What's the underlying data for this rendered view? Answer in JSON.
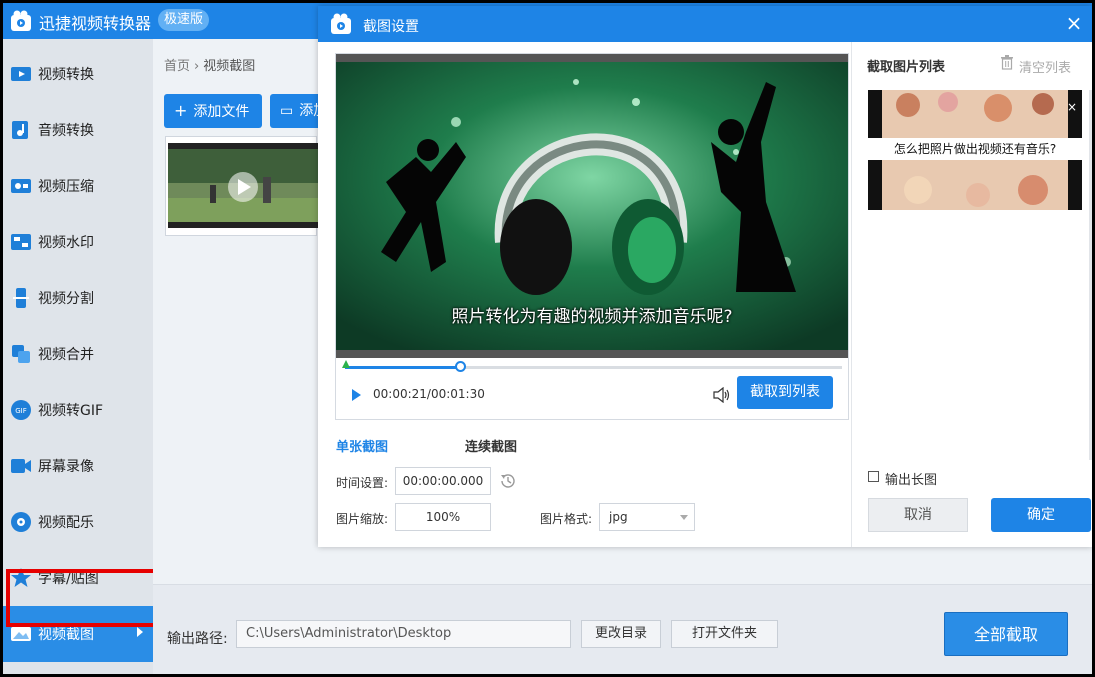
{
  "app": {
    "title": "迅捷视频转换器",
    "badge": "极速版",
    "brand_color": "#1e84e6"
  },
  "sidebar": {
    "items": [
      {
        "label": "视频转换",
        "icon": "video-convert-icon"
      },
      {
        "label": "音频转换",
        "icon": "audio-convert-icon"
      },
      {
        "label": "视频压缩",
        "icon": "video-compress-icon"
      },
      {
        "label": "视频水印",
        "icon": "video-watermark-icon"
      },
      {
        "label": "视频分割",
        "icon": "video-split-icon"
      },
      {
        "label": "视频合并",
        "icon": "video-merge-icon"
      },
      {
        "label": "视频转GIF",
        "icon": "video-gif-icon"
      },
      {
        "label": "屏幕录像",
        "icon": "screen-record-icon"
      },
      {
        "label": "视频配乐",
        "icon": "video-music-icon"
      },
      {
        "label": "字幕/贴图",
        "icon": "subtitle-sticker-icon"
      },
      {
        "label": "视频截图",
        "icon": "video-screenshot-icon",
        "active": true
      }
    ],
    "highlight_color": "#e60000"
  },
  "main": {
    "breadcrumb": {
      "home": "首页",
      "separator": "›",
      "current": "视频截图"
    },
    "add_file_label": "添加文件",
    "add_folder_label": "添加",
    "output": {
      "label": "输出路径:",
      "path": "C:\\Users\\Administrator\\Desktop",
      "change_dir_label": "更改目录",
      "open_folder_label": "打开文件夹",
      "capture_all_label": "全部截取"
    }
  },
  "dialog": {
    "title": "截图设置",
    "close_glyph": "×",
    "video": {
      "subtitle": "照片转化为有趣的视频并添加音乐呢?",
      "time_current": "00:00:21",
      "time_total": "00:01:30",
      "progress": 0.233,
      "capture_label": "截取到列表"
    },
    "tabs": [
      {
        "label": "单张截图",
        "active": true
      },
      {
        "label": "连续截图",
        "active": false
      }
    ],
    "fields": {
      "time_label": "时间设置:",
      "time_value": "00:00:00.000",
      "scale_label": "图片缩放:",
      "scale_value": "100%",
      "format_label": "图片格式:",
      "format_value": "jpg"
    },
    "right_panel": {
      "title": "截取图片列表",
      "clear_label": "清空列表",
      "thumb_caption": "怎么把照片做出视频还有音乐?",
      "thumb_close": "×",
      "long_image_label": "输出长图",
      "long_image_checked": false,
      "cancel_label": "取消",
      "ok_label": "确定"
    }
  }
}
